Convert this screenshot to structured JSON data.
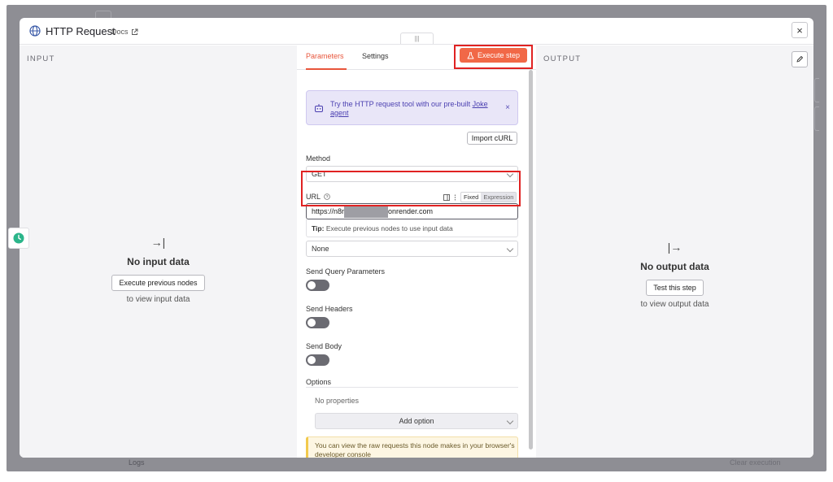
{
  "background": {
    "logs_label": "Logs",
    "clear_label": "Clear execution"
  },
  "modal": {
    "title": "HTTP Request",
    "docs_label": "Docs",
    "close_glyph": "×",
    "drag_glyph": "|||"
  },
  "input_panel": {
    "label": "INPUT",
    "icon_glyph": "→|",
    "title": "No input data",
    "button": "Execute previous nodes",
    "subtitle": "to view input data"
  },
  "output_panel": {
    "label": "OUTPUT",
    "icon_glyph": "|→",
    "title": "No output data",
    "button": "Test this step",
    "subtitle": "to view output data"
  },
  "tabs": [
    {
      "label": "Parameters",
      "active": true
    },
    {
      "label": "Settings",
      "active": false
    }
  ],
  "execute_button": "Execute step",
  "banner": {
    "text": "Try the HTTP request tool with our pre-built",
    "link": "Joke agent",
    "close_glyph": "×"
  },
  "import_curl": "Import cURL",
  "method": {
    "label": "Method",
    "value": "GET"
  },
  "url": {
    "label": "URL",
    "mode_fixed": "Fixed",
    "mode_expression": "Expression",
    "value_start": "https://n8r",
    "value_end": "onrender.com",
    "tip_bold": "Tip:",
    "tip_text": "Execute previous nodes to use input data"
  },
  "auth": {
    "value": "None"
  },
  "send_query": {
    "label": "Send Query Parameters"
  },
  "send_headers": {
    "label": "Send Headers"
  },
  "send_body": {
    "label": "Send Body"
  },
  "options": {
    "label": "Options",
    "empty": "No properties",
    "add_button": "Add option"
  },
  "notice": "You can view the raw requests this node makes in your browser's developer console",
  "colors": {
    "accent": "#f16847",
    "highlight": "#e02222",
    "banner_bg": "#e9e6f8",
    "notice_bg": "#fdf6e3"
  },
  "icons": [
    "globe-icon",
    "external-link-icon",
    "close-icon",
    "pencil-icon",
    "clock-icon",
    "flask-icon",
    "robot-icon",
    "help-circle-icon",
    "chevron-down-icon"
  ]
}
